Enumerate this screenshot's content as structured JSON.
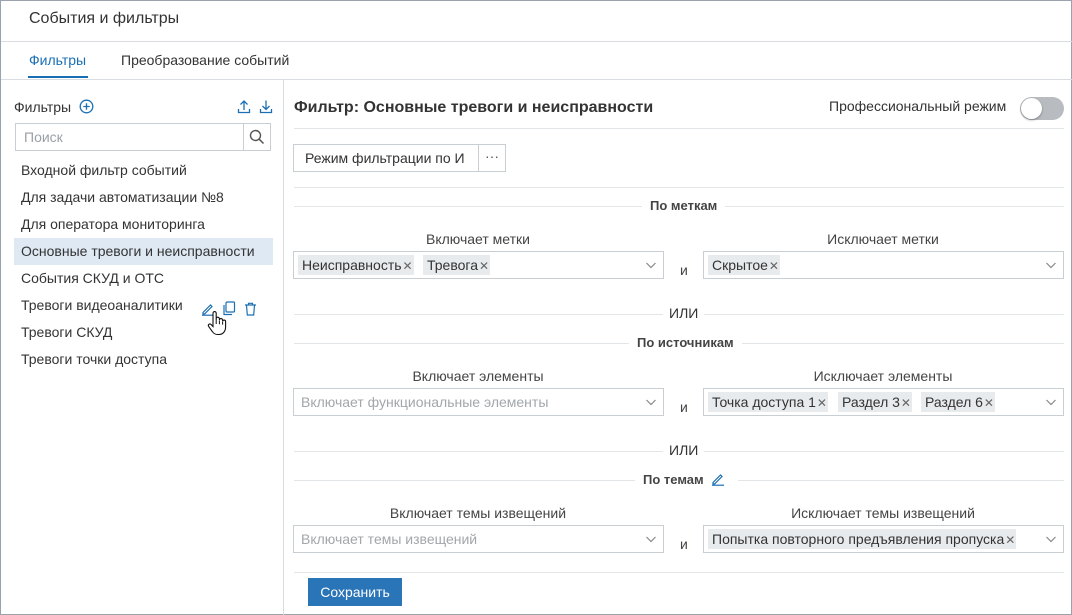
{
  "window": {
    "title": "События и фильтры"
  },
  "tabs": [
    {
      "label": "Фильтры",
      "active": true
    },
    {
      "label": "Преобразование событий",
      "active": false
    }
  ],
  "sidebar": {
    "heading": "Фильтры",
    "search_placeholder": "Поиск",
    "items": [
      {
        "label": "Входной фильтр событий"
      },
      {
        "label": "Для задачи автоматизации №8"
      },
      {
        "label": "Для оператора мониторинга"
      },
      {
        "label": "Основные тревоги и неисправности",
        "selected": true
      },
      {
        "label": "События СКУД и ОТС"
      },
      {
        "label": "Тревоги видеоаналитики",
        "hovered": true
      },
      {
        "label": "Тревоги СКУД"
      },
      {
        "label": "Тревоги точки доступа"
      }
    ]
  },
  "main": {
    "title": "Фильтр: Основные тревоги и неисправности",
    "pro_mode_label": "Профессиональный режим",
    "pro_mode_on": false,
    "mode_button": "Режим фильтрации по И",
    "more_button": "···",
    "or_label": "ИЛИ",
    "and_label": "и",
    "save_button": "Сохранить",
    "sections": {
      "tags": {
        "title": "По меткам",
        "include_label": "Включает метки",
        "include_chips": [
          "Неисправность",
          "Тревога"
        ],
        "exclude_label": "Исключает метки",
        "exclude_chips": [
          "Скрытое"
        ]
      },
      "sources": {
        "title": "По источникам",
        "include_label": "Включает элементы",
        "include_placeholder": "Включает функциональные элементы",
        "exclude_label": "Исключает элементы",
        "exclude_chips": [
          "Точка доступа 1",
          "Раздел 3",
          "Раздел 6"
        ]
      },
      "topics": {
        "title": "По темам",
        "include_label": "Включает темы извещений",
        "include_placeholder": "Включает темы извещений",
        "exclude_label": "Исключает темы извещений",
        "exclude_chips": [
          "Попытка повторного предъявления пропуска"
        ]
      }
    }
  },
  "colors": {
    "accent": "#1a6fb4",
    "selected_row": "#dfe9f3",
    "save_button": "#2a74b8",
    "chip_bg": "#e8ebee",
    "toggle_off": "#b8bcc0"
  },
  "icons": {
    "add": "plus-circle-icon",
    "export": "upload-icon",
    "import": "download-icon",
    "search": "search-icon",
    "edit": "pencil-icon",
    "copy": "copy-icon",
    "delete": "trash-icon",
    "dropdown": "chevron-down-icon",
    "cursor": "hand-cursor-icon"
  }
}
